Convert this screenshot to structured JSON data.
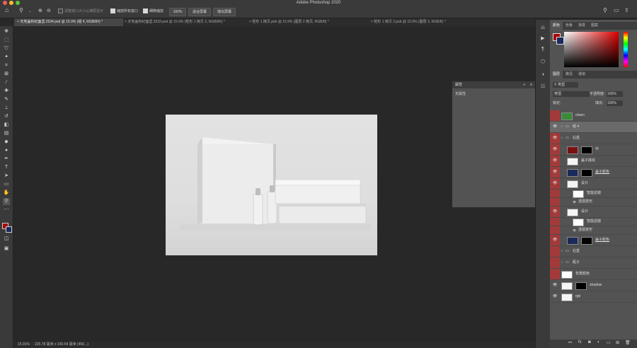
{
  "app": {
    "title": "Adobe Photoshop 2020"
  },
  "colors": {
    "accent_red": "#a33a3a",
    "fg_color": "#a80000",
    "bg_color": "#1a2a5a"
  },
  "options_bar": {
    "scroll_all_label": "调整窗口大小以满屏显示",
    "zoom_all_label": "缩放所有窗口",
    "scrubby_zoom_label": "细微缩放",
    "zoom_value": "100%",
    "fit_screen_label": "适合屏幕",
    "fill_screen_label": "填充屏幕"
  },
  "tabs": [
    {
      "label": "天地盖构纪面坚.2534.psd @ 15.9% (组 4, RGB/8#) *",
      "close": "×"
    },
    {
      "label": "天地盖构纪面坚.2533.psd @ 15.9% (矩形 1 拷贝 2, RGB/8#) *",
      "close": "×"
    },
    {
      "label": "矩形 1 拷贝.psb @ 15.9% (图层 2 拷贝, RGB/8) *",
      "close": "×"
    },
    {
      "label": "矩形 1 拷贝 2.psb @ 15.9% (图层 3, RGB/8) *",
      "close": "×"
    }
  ],
  "properties": {
    "title": "属性",
    "body": "无属性"
  },
  "color_panel": {
    "tabs": [
      "颜色",
      "色板",
      "渐变",
      "图案"
    ]
  },
  "layers_panel": {
    "tabs": [
      "图层",
      "路径",
      "通道"
    ],
    "filter_label": "类型",
    "blend_mode": "穿透",
    "opacity_label": "不透明度:",
    "opacity_value": "100%",
    "lock_label": "锁定:",
    "fill_label": "填充:",
    "fill_value": "100%",
    "layers": [
      {
        "name": "clown",
        "indent": 0,
        "red": true,
        "eye": false,
        "kind": "layer"
      },
      {
        "name": "组 4",
        "indent": 0,
        "red": false,
        "eye": true,
        "kind": "group",
        "selected": true
      },
      {
        "name": "右盒",
        "indent": 0,
        "red": true,
        "eye": true,
        "kind": "group"
      },
      {
        "name": "中",
        "indent": 1,
        "red": true,
        "eye": true,
        "kind": "layer"
      },
      {
        "name": "盖子底纹",
        "indent": 1,
        "red": true,
        "eye": true,
        "kind": "smart"
      },
      {
        "name": "盖子颜色",
        "indent": 1,
        "red": true,
        "eye": true,
        "kind": "layer",
        "underline": true
      },
      {
        "name": "设计",
        "indent": 1,
        "red": true,
        "eye": true,
        "kind": "smart"
      },
      {
        "name": "智能滤镜",
        "indent": 2,
        "red": true,
        "eye": false,
        "kind": "filter"
      },
      {
        "name": "透视变形",
        "indent": 3,
        "red": true,
        "eye": false,
        "kind": "sub"
      },
      {
        "name": "设计",
        "indent": 1,
        "red": true,
        "eye": true,
        "kind": "smart"
      },
      {
        "name": "智能滤镜",
        "indent": 2,
        "red": true,
        "eye": false,
        "kind": "filter"
      },
      {
        "name": "透视变形",
        "indent": 3,
        "red": true,
        "eye": false,
        "kind": "sub"
      },
      {
        "name": "盖子颜色",
        "indent": 1,
        "red": true,
        "eye": true,
        "kind": "layer",
        "underline": true
      },
      {
        "name": "右盒",
        "indent": 0,
        "red": true,
        "eye": false,
        "kind": "group"
      },
      {
        "name": "瓶子",
        "indent": 0,
        "red": true,
        "eye": false,
        "kind": "group"
      },
      {
        "name": "背景颜色",
        "indent": 0,
        "red": true,
        "eye": false,
        "kind": "adjust"
      },
      {
        "name": "shadow",
        "indent": 0,
        "red": false,
        "eye": true,
        "kind": "layer"
      },
      {
        "name": "rgb",
        "indent": 0,
        "red": false,
        "eye": true,
        "kind": "layer"
      }
    ],
    "footer_icons": [
      "link-icon",
      "fx-icon",
      "mask-icon",
      "adjustment-icon",
      "folder-icon",
      "new-layer-icon",
      "trash-icon"
    ]
  },
  "status": {
    "zoom": "15.91%",
    "doc_size": "225.78 毫米 x 150.54 毫米 (450...)"
  }
}
